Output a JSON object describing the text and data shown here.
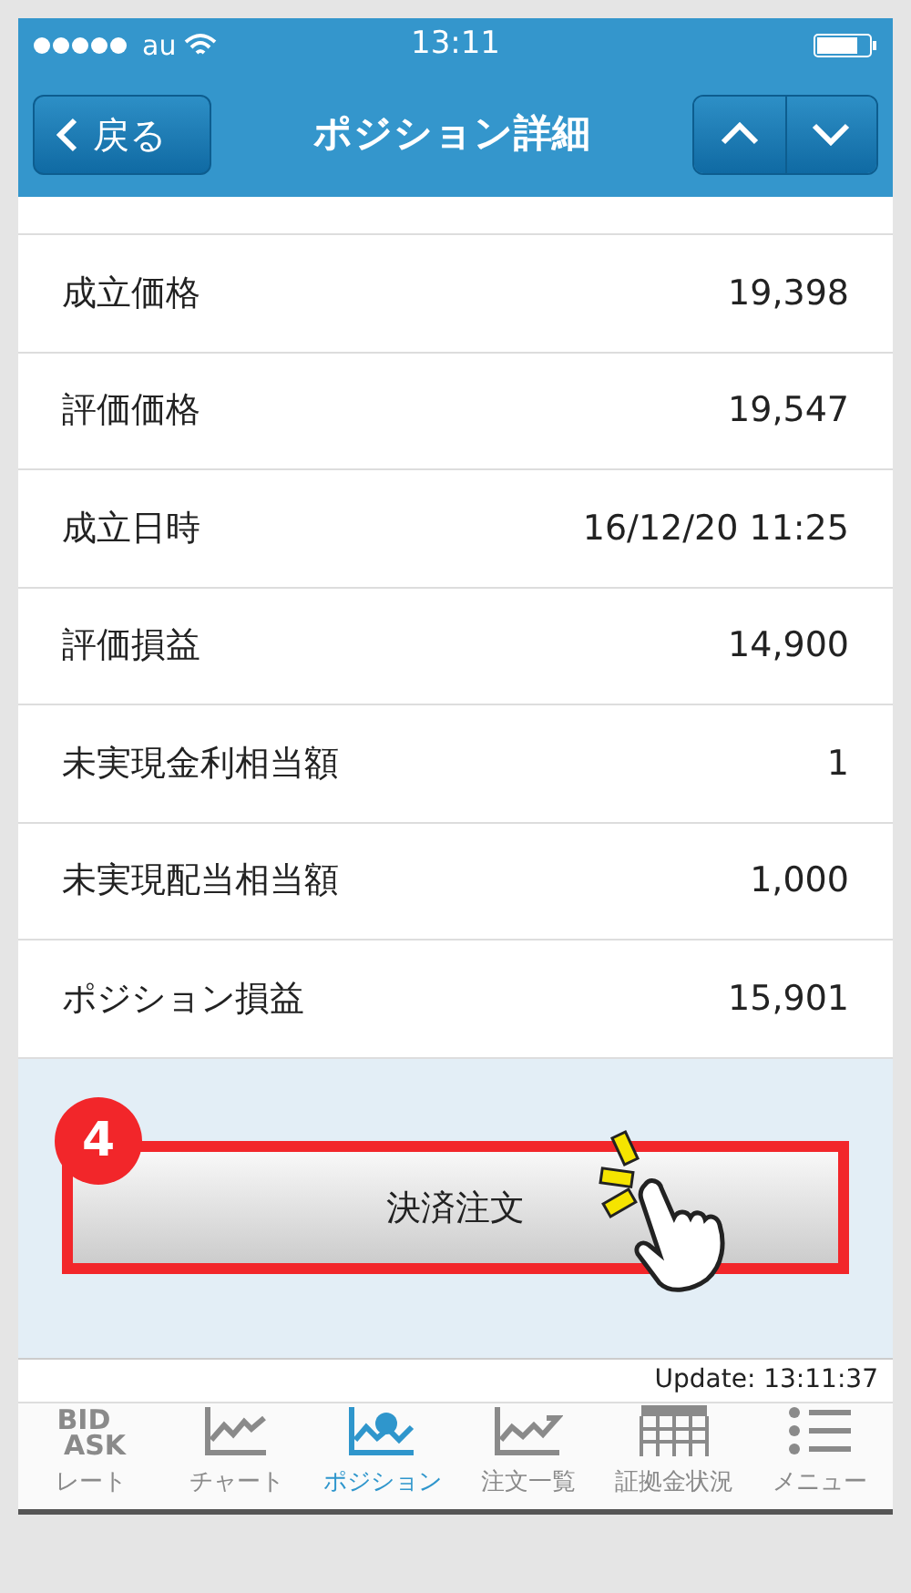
{
  "status_bar": {
    "carrier": "au",
    "time": "13:11"
  },
  "nav": {
    "back": "戻る",
    "title": "ポジション詳細"
  },
  "rows": [
    {
      "label": "成立価格",
      "value": "19,398"
    },
    {
      "label": "評価価格",
      "value": "19,547"
    },
    {
      "label": "成立日時",
      "value": "16/12/20 11:25"
    },
    {
      "label": "評価損益",
      "value": "14,900"
    },
    {
      "label": "未実現金利相当額",
      "value": "1"
    },
    {
      "label": "未実現配当相当額",
      "value": "1,000"
    },
    {
      "label": "ポジション損益",
      "value": "15,901"
    }
  ],
  "action": {
    "step": "4",
    "label": "決済注文"
  },
  "update": "Update: 13:11:37",
  "tabs": [
    {
      "kind": "bidask",
      "icon_text": [
        "BID",
        "ASK"
      ],
      "label": "レート",
      "selected": false
    },
    {
      "kind": "chart",
      "label": "チャート",
      "selected": false
    },
    {
      "kind": "position",
      "label": "ポジション",
      "selected": true
    },
    {
      "kind": "orders",
      "label": "注文一覧",
      "selected": false
    },
    {
      "kind": "table",
      "label": "証拠金状況",
      "selected": false
    },
    {
      "kind": "menu",
      "label": "メニュー",
      "selected": false
    }
  ]
}
